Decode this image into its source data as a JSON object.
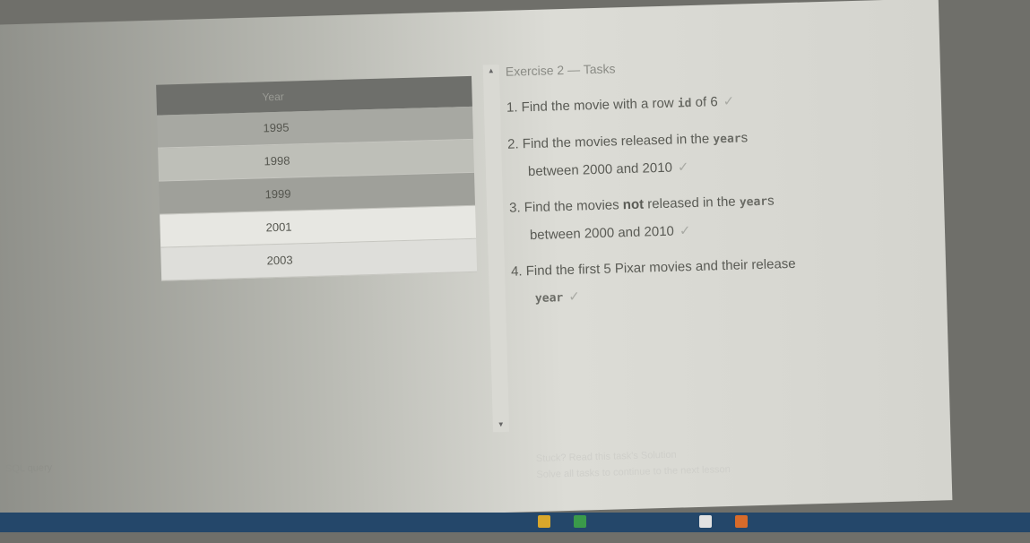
{
  "table": {
    "header": "Year",
    "rows": [
      "1995",
      "1998",
      "1999",
      "2001",
      "2003"
    ]
  },
  "tasks": {
    "title": "Exercise 2 — Tasks",
    "items": [
      {
        "pre": "1. Find the movie with a row ",
        "code": "id",
        "post": " of 6",
        "line2": ""
      },
      {
        "pre": "2. Find the movies released in the ",
        "code": "year",
        "post": "s",
        "line2": "between 2000 and 2010"
      },
      {
        "pre": "3. Find the movies ",
        "bold": "not",
        "mid": " released in the ",
        "code": "year",
        "post": "s",
        "line2": "between 2000 and 2010"
      },
      {
        "pre": "4. Find the first 5 Pixar movies and their release",
        "code2": "year"
      }
    ],
    "check_symbol": "✓"
  },
  "footer": {
    "hint": "Stuck? Read this task's Solution",
    "note": "Solve all tasks to continue to the next lesson"
  },
  "misc": {
    "left_label": "SQL query"
  },
  "colors": {
    "taskbar": "#24476a",
    "row_highlight": "#e7e7e2"
  }
}
